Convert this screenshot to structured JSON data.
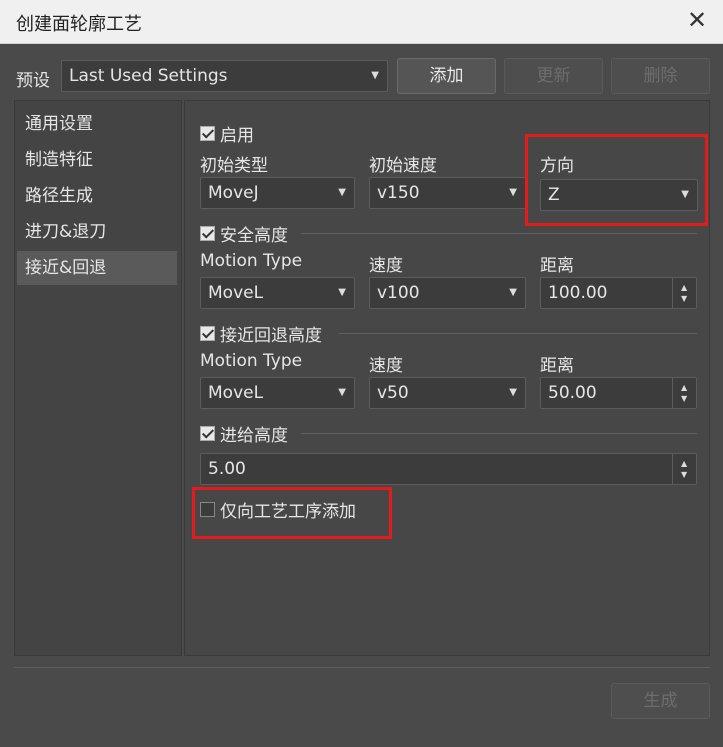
{
  "window": {
    "title": "创建面轮廓工艺",
    "close_glyph": "✕"
  },
  "preset": {
    "label": "预设",
    "value": "Last Used Settings",
    "add": "添加",
    "update": "更新",
    "delete": "删除"
  },
  "sidebar": {
    "items": [
      {
        "label": "通用设置"
      },
      {
        "label": "制造特征"
      },
      {
        "label": "路径生成"
      },
      {
        "label": "进刀&退刀"
      },
      {
        "label": "接近&回退",
        "active": true
      }
    ]
  },
  "enable": {
    "label": "启用",
    "checked": true,
    "init_type_label": "初始类型",
    "init_type_value": "MoveJ",
    "init_speed_label": "初始速度",
    "init_speed_value": "v150",
    "direction_label": "方向",
    "direction_value": "Z"
  },
  "safe_height": {
    "label": "安全高度",
    "checked": true,
    "motion_type_label": "Motion Type",
    "motion_type_value": "MoveL",
    "speed_label": "速度",
    "speed_value": "v100",
    "distance_label": "距离",
    "distance_value": "100.00"
  },
  "approach_height": {
    "label": "接近回退高度",
    "checked": true,
    "motion_type_label": "Motion Type",
    "motion_type_value": "MoveL",
    "speed_label": "速度",
    "speed_value": "v50",
    "distance_label": "距离",
    "distance_value": "50.00"
  },
  "feed_height": {
    "label": "进给高度",
    "checked": true,
    "value": "5.00"
  },
  "only_add": {
    "label": "仅向工艺工序添加",
    "checked": false
  },
  "footer": {
    "generate": "生成"
  },
  "colors": {
    "highlight": "#e21b1b",
    "background": "#4a4a4a"
  },
  "icons": {
    "combo_arrow": "▼",
    "spin_up": "▲",
    "spin_down": "▼"
  }
}
